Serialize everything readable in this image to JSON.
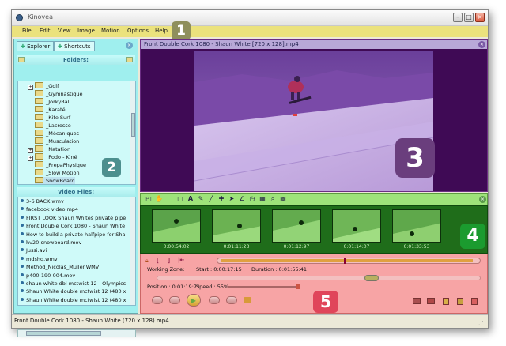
{
  "window": {
    "title": "Kinovea",
    "status": "Front Double Cork 1080 - Shaun White (720 x 128).mp4"
  },
  "menu": [
    "File",
    "Edit",
    "View",
    "Image",
    "Motion",
    "Options",
    "Help"
  ],
  "badges": [
    "1",
    "2",
    "3",
    "4",
    "5"
  ],
  "colors": {
    "menu": "#ebe27d",
    "left_panel": "#9fefee",
    "viewer": "#3f0a55",
    "thumbs": "#1f6d1a",
    "controls": "#f7a4a5"
  },
  "tabs": [
    "Explorer",
    "Shortcuts"
  ],
  "folders_header": "Folders:",
  "folders": [
    {
      "label": "_Golf",
      "expander": "+"
    },
    {
      "label": "_Gymnastique",
      "expander": ""
    },
    {
      "label": "_JorkyBall",
      "expander": ""
    },
    {
      "label": "_Karaté",
      "expander": ""
    },
    {
      "label": "_Kite Surf",
      "expander": ""
    },
    {
      "label": "_Lacrosse",
      "expander": ""
    },
    {
      "label": "_Mécaniques",
      "expander": ""
    },
    {
      "label": "_Musculation",
      "expander": ""
    },
    {
      "label": "_Natation",
      "expander": "+"
    },
    {
      "label": "_Podo - Kiné",
      "expander": "+"
    },
    {
      "label": "_PrepaPhysique",
      "expander": ""
    },
    {
      "label": "_Slow Motion",
      "expander": ""
    },
    {
      "label": "SnowBoard",
      "expander": ""
    }
  ],
  "files_header": "Video Files:",
  "files": [
    "3-6 BACK.wmv",
    "facebook video.mp4",
    "FIRST LOOK Shaun Whites private pipe - Re",
    "Front Double Cork 1080 - Shaun White (720",
    "How to build a private halfpipe for Shaun W",
    "hv20-snowboard.mov",
    "Jussi.avi",
    "mdshq.wmv",
    "Method_Nicolas_Muller.WMV",
    "p400-190-004.mov",
    "shaun white dbl mctwist 12 - Olympics2010.fl",
    "Shaun White double mctwist 12 (480 x 360).",
    "Shaun White double mctwist 12 (480 x 360)."
  ],
  "viewer": {
    "title": "Front Double Cork 1080 - Shaun White [720 x 128].mp4"
  },
  "thumbs": [
    "0:00:54:02",
    "0:01:11:23",
    "0:01:12:97",
    "0:01:14:07",
    "0:01:33:53"
  ],
  "controls": {
    "working_zone_label": "Working Zone:",
    "start": "Start : 0:00:17:15",
    "duration": "Duration : 0:01:55:41",
    "position": "Position : 0:01:19:71",
    "speed": "Speed : 55%"
  }
}
